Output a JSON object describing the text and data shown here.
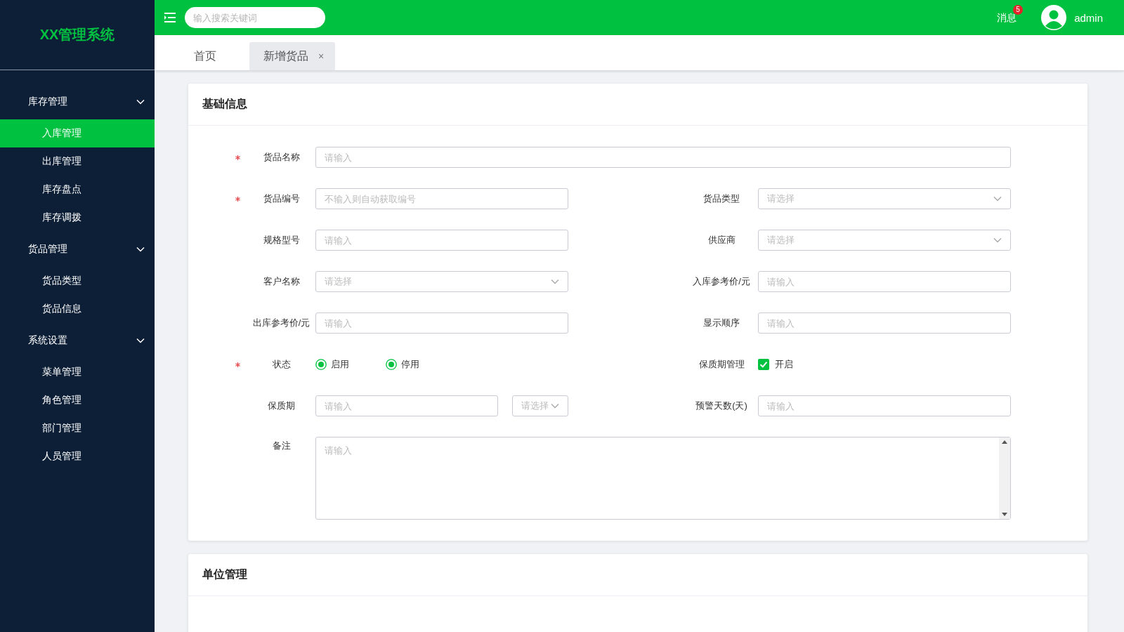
{
  "sidebar": {
    "logo": "XX管理系统",
    "groups": [
      {
        "label": "库存管理",
        "expanded": true,
        "items": [
          {
            "label": "入库管理",
            "selected": true
          },
          {
            "label": "出库管理",
            "selected": false
          },
          {
            "label": "库存盘点",
            "selected": false
          },
          {
            "label": "库存调拨",
            "selected": false
          }
        ]
      },
      {
        "label": "货品管理",
        "expanded": true,
        "items": [
          {
            "label": "货品类型",
            "selected": false
          },
          {
            "label": "货品信息",
            "selected": false
          }
        ]
      },
      {
        "label": "系统设置",
        "expanded": true,
        "items": [
          {
            "label": "菜单管理",
            "selected": false
          },
          {
            "label": "角色管理",
            "selected": false
          },
          {
            "label": "部门管理",
            "selected": false
          },
          {
            "label": "人员管理",
            "selected": false
          }
        ]
      }
    ]
  },
  "topbar": {
    "search": {
      "placeholder": "输入搜索关键词"
    },
    "messages": {
      "label": "消息",
      "badge": "5"
    },
    "user": {
      "name": "admin"
    }
  },
  "tabs": [
    {
      "label": "首页",
      "selected": false
    },
    {
      "label": "新增货品",
      "selected": true,
      "close": "×"
    }
  ],
  "sections": [
    {
      "title": "基础信息",
      "rows": [
        [
          {
            "label": "货品名称",
            "required": true,
            "kind": "input",
            "placeholder": "请输入"
          }
        ],
        [
          {
            "label": "货品编号",
            "required": true,
            "kind": "input",
            "placeholder": "不输入则自动获取编号"
          },
          {
            "label": "货品类型",
            "required": false,
            "kind": "select",
            "placeholder": "请选择"
          }
        ],
        [
          {
            "label": "规格型号",
            "required": false,
            "kind": "input",
            "placeholder": "请输入"
          },
          {
            "label": "供应商",
            "required": false,
            "kind": "select",
            "placeholder": "请选择"
          }
        ],
        [
          {
            "label": "客户名称",
            "required": false,
            "kind": "select",
            "placeholder": "请选择"
          },
          {
            "label": "入库参考价/元",
            "required": false,
            "kind": "input",
            "placeholder": "请输入"
          }
        ],
        [
          {
            "label": "出库参考价/元",
            "required": false,
            "kind": "input",
            "placeholder": "请输入"
          },
          {
            "label": "显示顺序",
            "required": false,
            "kind": "input",
            "placeholder": "请输入"
          }
        ],
        [
          {
            "label": "状态",
            "required": true,
            "kind": "radio",
            "options": [
              {
                "label": "启用",
                "selected": true
              },
              {
                "label": "停用",
                "selected": true
              }
            ]
          },
          {
            "label": "保质期管理",
            "required": false,
            "kind": "checkbox",
            "checked": true,
            "option": "开启"
          }
        ],
        [
          {
            "label": "保质期",
            "required": false,
            "kind": "combo",
            "placeholder": "请输入",
            "select_placeholder": "请选择"
          },
          {
            "label": "预警天数(天)",
            "required": false,
            "kind": "input",
            "placeholder": "请输入"
          }
        ],
        [
          {
            "label": "备注",
            "required": false,
            "kind": "textarea",
            "placeholder": "请输入"
          }
        ]
      ]
    },
    {
      "title": "单位管理"
    }
  ]
}
